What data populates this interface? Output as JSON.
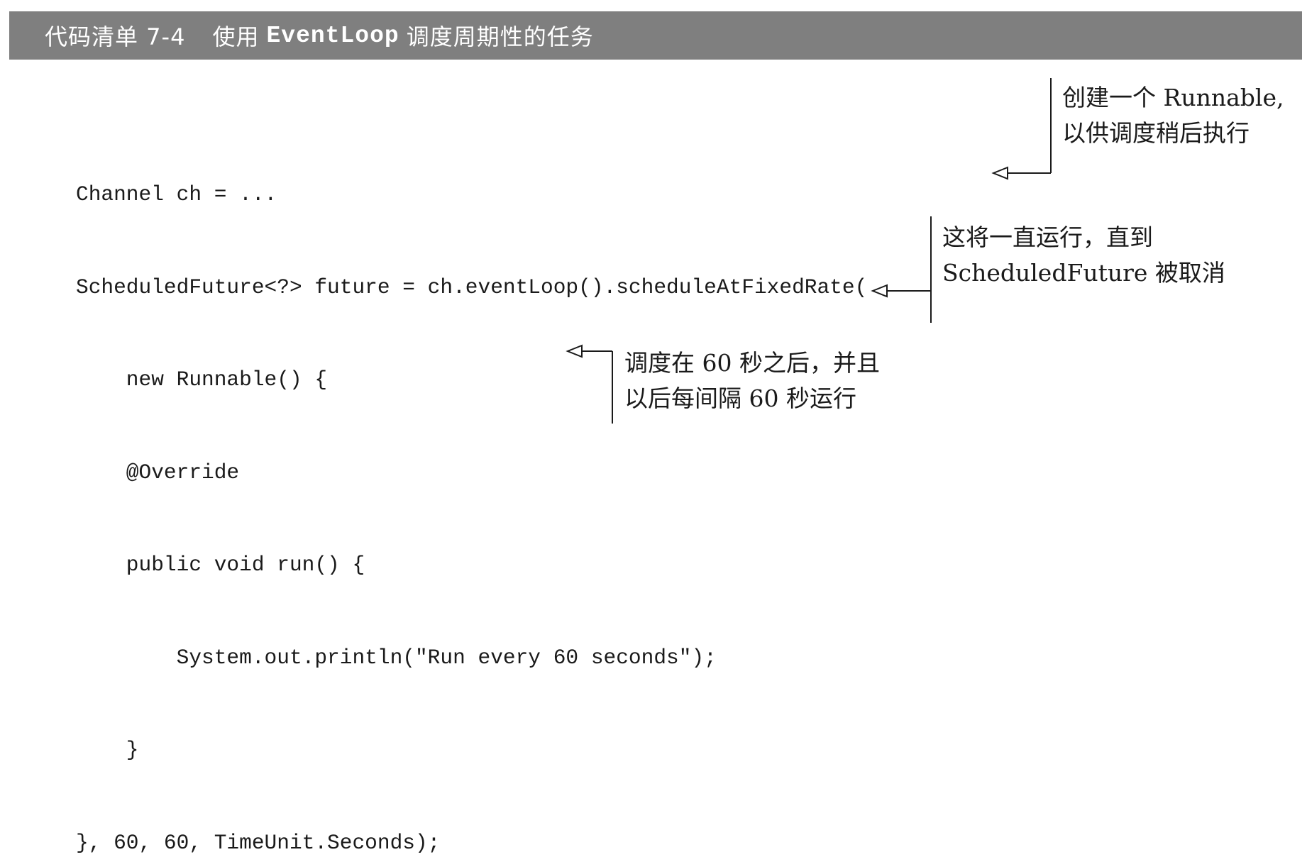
{
  "listing": {
    "label": "代码清单 7-4",
    "title_before": "使用",
    "title_code": "EventLoop",
    "title_after": "调度周期性的任务"
  },
  "code": {
    "lines": [
      "Channel ch = ...",
      "ScheduledFuture<?> future = ch.eventLoop().scheduleAtFixedRate(",
      "    new Runnable() {",
      "    @Override",
      "    public void run() {",
      "        System.out.println(\"Run every 60 seconds\");",
      "    }",
      "}, 60, 60, TimeUnit.Seconds);"
    ]
  },
  "annotations": {
    "runnable": {
      "line1": "创建一个 Runnable,",
      "line2": "以供调度稍后执行"
    },
    "run_until": {
      "line1": "这将一直运行，直到",
      "line2": "ScheduledFuture 被取消"
    },
    "schedule": {
      "line1": "调度在 60 秒之后，并且",
      "line2": "以后每间隔 60 秒运行"
    }
  }
}
